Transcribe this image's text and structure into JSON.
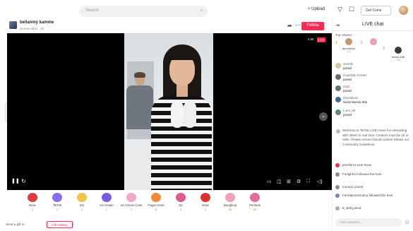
{
  "topbar": {
    "search_placeholder": "Search",
    "upload_label": "+ Upload",
    "get_coins_label": "Get Coins"
  },
  "stream": {
    "host_name": "bellanmy kamme",
    "host_sub": "yvonne ellyn · 2K",
    "follow_label": "Follow",
    "viewer_count": "4.5K",
    "live_badge": "LIVE"
  },
  "gifts": [
    {
      "name": "Rose",
      "price": "1",
      "color": "#e23b3b"
    },
    {
      "name": "TikTok",
      "price": "1",
      "color": "#8a6cf0"
    },
    {
      "name": "GG",
      "price": "1",
      "color": "#f2c24a"
    },
    {
      "name": "Ice Cream",
      "price": "1",
      "color": "#7a5ae0"
    },
    {
      "name": "Ice Cream Cone",
      "price": "1",
      "color": "#f0a7c8"
    },
    {
      "name": "Finger Heart",
      "price": "5",
      "color": "#f28a3c"
    },
    {
      "name": "DJ",
      "price": "5",
      "color": "#e05a8a"
    },
    {
      "name": "Rose",
      "price": "1",
      "color": "#d83232"
    },
    {
      "name": "Doughnut",
      "price": "30",
      "color": "#f0a0b8"
    },
    {
      "name": "Perfume",
      "price": "20",
      "color": "#e46aa0"
    }
  ],
  "bottom": {
    "left_text": "Send a gift to",
    "button_label": "Gift Gallery"
  },
  "chat": {
    "title": "LIVE chat",
    "top_viewers_label": "Top viewers",
    "top_viewers": [
      {
        "name": "apmutleys",
        "count": "4.5",
        "color": "#c8986a"
      },
      {
        "name": "",
        "count": "",
        "color": "#e7a2b4"
      },
      {
        "name": "kessir 888",
        "count": "1.8",
        "color": "#3a3a3a"
      }
    ],
    "entries": [
      {
        "name": "Jenelle",
        "text": "joined",
        "color": "#d7c3a4"
      },
      {
        "name": "Guardian Kirsten",
        "text": "joined",
        "color": "#6a6a6a"
      },
      {
        "name": "Hani",
        "text": "joined",
        "color": "#5a7a5a"
      },
      {
        "name": "Omniatxxx",
        "text": "Surat Muesa Mai",
        "color": "#3f6d8f"
      },
      {
        "name": "Lumi_08",
        "text": "joined",
        "color": "#5a8a7a"
      }
    ],
    "notice": "Welcome to TikTok LIVE! Have fun interacting with others in real time. Creators must be 18 or older. Please ensure that all content follows our Community Guidelines.",
    "messages": [
      {
        "text": "jennifer14 sent Rose",
        "color": "#e23b3b"
      },
      {
        "text": "Forlight14 followed the host",
        "color": "#888888"
      },
      {
        "text": "Inoue11 joined",
        "color": "#8a8a8a"
      },
      {
        "text": "Fernaduvnimutmu followed the host",
        "color": "#6a8ac0"
      },
      {
        "text": "E_Bell joined",
        "color": "#aaaaaa"
      }
    ],
    "input_placeholder": "Add comment..."
  }
}
